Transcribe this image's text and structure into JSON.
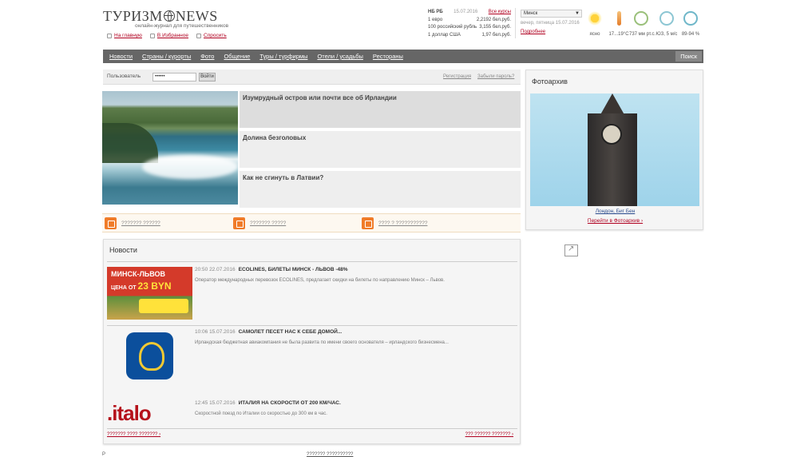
{
  "header": {
    "logo_text_left": "ТУРИЗМ",
    "logo_text_right": "NEWS",
    "logo_subtitle": "онлайн-журнал для путешественников",
    "links": [
      {
        "label": "На главную"
      },
      {
        "label": "В Избранное"
      },
      {
        "label": "Спросить"
      }
    ]
  },
  "rates": {
    "title": "НБ РБ",
    "date": "15.07.2016",
    "all_link": "Все курсы",
    "rows": [
      {
        "name": "1 евро",
        "value": "2,2192 бел.руб."
      },
      {
        "name": "100 российский рубль",
        "value": "3,155 бел.руб."
      },
      {
        "name": "1 доллар США",
        "value": "1,97 бел.руб."
      }
    ]
  },
  "weather": {
    "city": "Минск",
    "date_line": "вечер, пятница 15.07.2016",
    "more_link": "Подробнее",
    "items": [
      {
        "icon": "sun-icon",
        "value": "ясно"
      },
      {
        "icon": "thermometer-icon",
        "value": "17...19°C"
      },
      {
        "icon": "pressure-icon",
        "value": "737 мм рт.с."
      },
      {
        "icon": "wind-icon",
        "value": "ЮЗ, 5 м/с"
      },
      {
        "icon": "humidity-icon",
        "value": "89-94 %"
      }
    ]
  },
  "nav": {
    "items": [
      "Новости",
      "Страны / курорты",
      "Фото",
      "Общение",
      "Туры / турфирмы",
      "Отели / усадьбы",
      "Рестораны"
    ],
    "search": "Поиск"
  },
  "login": {
    "user_label": "Пользователь",
    "password_value": "••••••",
    "button": "Войти",
    "register": "Регистрация",
    "forgot": "Забыли пароль?"
  },
  "featured": [
    {
      "title": "Изумрудный остров или почти все об Ирландии"
    },
    {
      "title": "Долина безголовых"
    },
    {
      "title": "Как не сгинуть в Латвии?"
    }
  ],
  "categories": [
    {
      "label": "??????? ??????"
    },
    {
      "label": "??????? ?????"
    },
    {
      "label": "???? ? ???????????"
    }
  ],
  "news": {
    "title": "Новости",
    "items": [
      {
        "datetime": "20:50 22.07.2016",
        "title": "ECOLINES, БИЛЕТЫ МИНСК - ЛЬВОВ -48%",
        "text": "Оператор международных перевозок ECOLINES, предлагает скидки на билеты по направлению Минск – Львов.",
        "thumb_line1": "МИНСК-ЛЬВОВ",
        "thumb_line2": "ЦЕНА ОТ",
        "thumb_price": "23 BYN"
      },
      {
        "datetime": "10:06 15.07.2016",
        "title": "САМОЛЕТ ПЕСЕТ НАС К СЕБЕ ДОМОЙ...",
        "text": "Ирландская бюджетная авиакомпания не была развита по имени своего основателя – ирландского бизнесмена..."
      },
      {
        "datetime": "12:45 15.07.2016",
        "title": "ИТАЛИЯ НА СКОРОСТИ ОТ 200 КМ/ЧАС.",
        "text": "Скоростной поезд по Италии со скоростью до 300 км в час.",
        "thumb_text": ".italo"
      }
    ],
    "footer_left": "??????? ???? ??????? ›",
    "footer_right": "??? ?????? ??????? ›"
  },
  "photo_archive": {
    "title": "Фотоархив",
    "caption": "Лондон, Биг Бен",
    "link": "Перейти в Фотоархив ›"
  },
  "bottom": {
    "left": "Р",
    "right": "??????? ??????????"
  }
}
